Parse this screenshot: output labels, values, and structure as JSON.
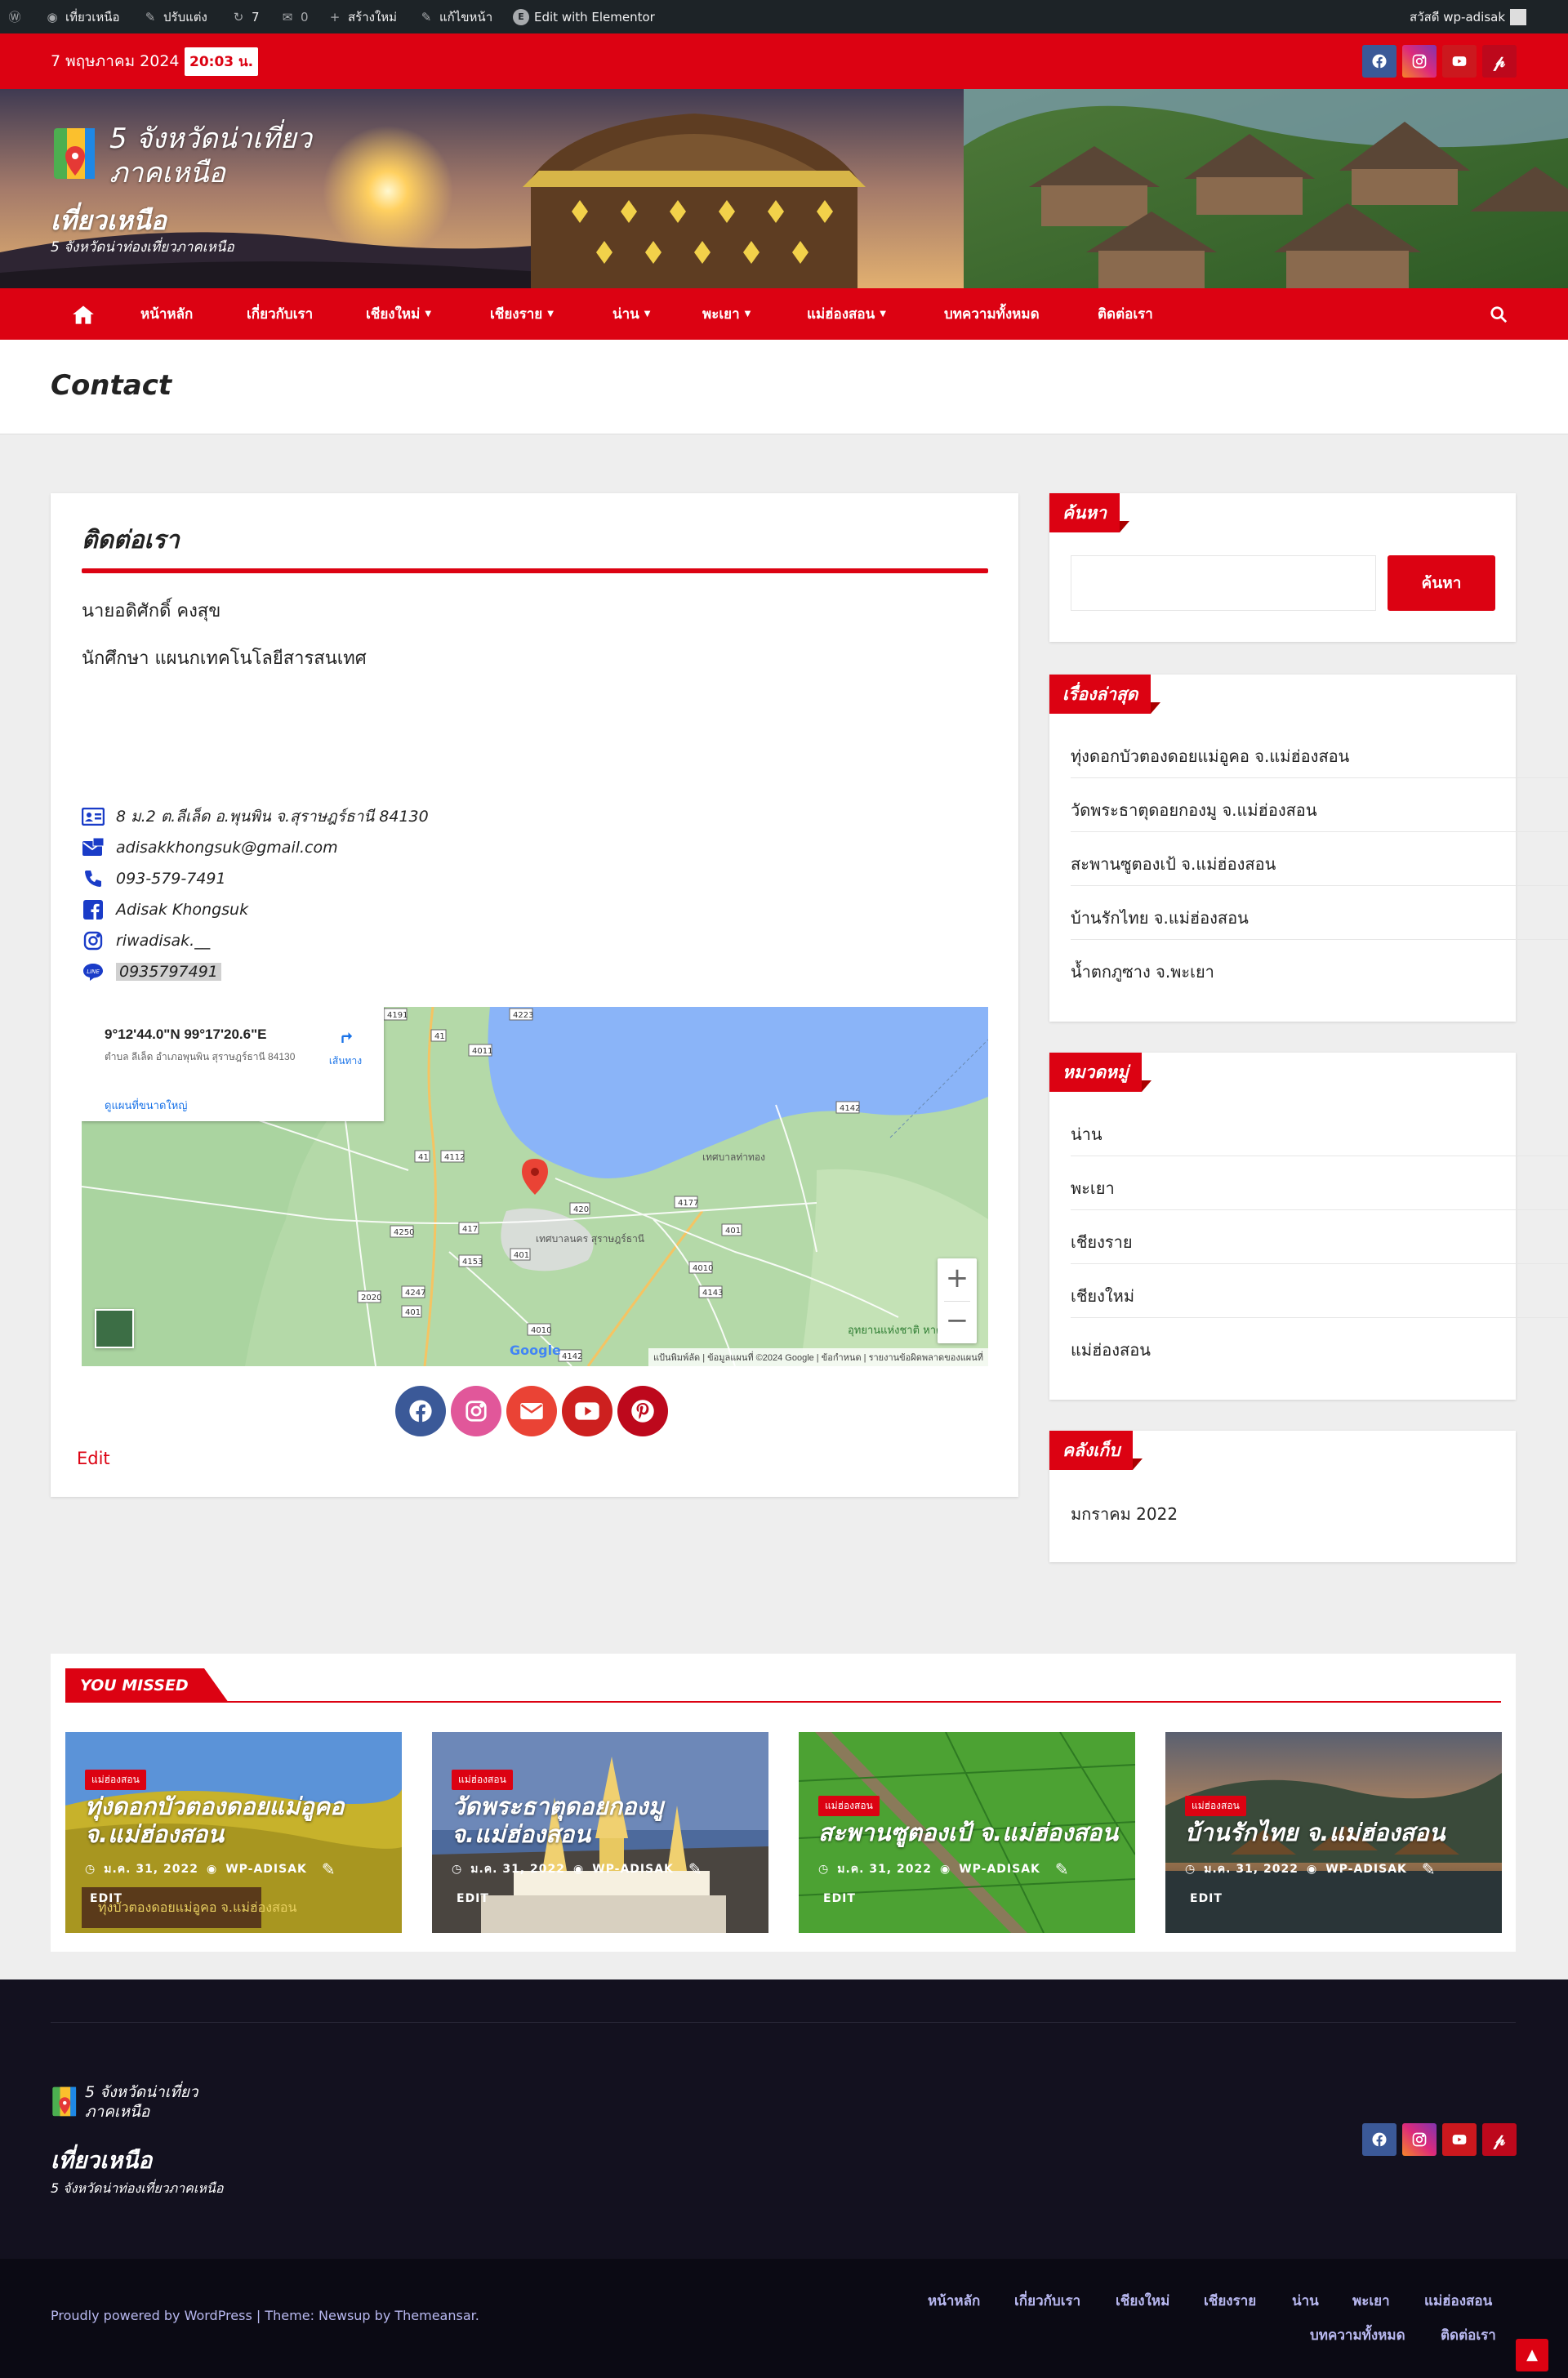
{
  "adminbar": {
    "items": [
      "เที่ยวเหนือ",
      "ปรับแต่ง",
      "7",
      "0",
      "สร้างใหม่",
      "แก้ไขหน้า",
      "Edit with Elementor"
    ],
    "greeting": "สวัสดี wp-adisak"
  },
  "topbar": {
    "date": "7 พฤษภาคม 2024",
    "time": "20:03 น."
  },
  "site": {
    "logo_text_line1": "5 จังหวัดน่าเที่ยว",
    "logo_text_line2": "ภาคเหนือ",
    "title": "เที่ยวเหนือ",
    "tagline": "5 จังหวัดน่าท่องเที่ยวภาคเหนือ"
  },
  "nav": {
    "items": [
      "หน้าหลัก",
      "เกี่ยวกับเรา",
      "เชียงใหม่",
      "เชียงราย",
      "น่าน",
      "พะเยา",
      "แม่ฮ่องสอน",
      "บทความทั้งหมด",
      "ติดต่อเรา"
    ]
  },
  "page": {
    "title": "Contact"
  },
  "contact": {
    "heading": "ติดต่อเรา",
    "name": "นายอดิศักดิ์ คงสุข",
    "role": "นักศึกษา แผนกเทคโนโลยีสารสนเทศ",
    "address": "8 ม.2 ต.ลีเล็ด อ.พุนพิน จ.สุราษฎร์ธานี 84130",
    "email": "adisakkhongsuk@gmail.com",
    "phone": "093-579-7491",
    "facebook": "Adisak Khongsuk",
    "instagram": "riwadisak.__",
    "line": "0935797491",
    "edit_label": "Edit"
  },
  "map": {
    "coords": "9°12'44.0\"N 99°17'20.6\"E",
    "place": "ตำบล ลีเล็ด อำเภอพุนพิน สุราษฎร์ธานี 84130",
    "directions": "เส้นทาง",
    "larger_map": "ดูแผนที่ขนาดใหญ่",
    "attribution": "แป้นพิมพ์ลัด | ข้อมูลแผนที่ ©2024 Google | ข้อกำหนด | รายงานข้อผิดพลาดของแผนที่",
    "zoom_in": "+",
    "zoom_out": "−",
    "google": "Google",
    "labels": [
      "เทศบาลท่าทอง",
      "เทศบาลนคร สุราษฎร์ธานี",
      "อุทยานแห่งชาติ หาดขนอม"
    ],
    "roads": [
      "4191",
      "41",
      "4011",
      "4223",
      "41",
      "4112",
      "417",
      "4250",
      "4153",
      "401",
      "420",
      "4177",
      "401",
      "4142",
      "4010",
      "4143",
      "2020",
      "4247",
      "401",
      "4010",
      "4142"
    ]
  },
  "social_circle": {
    "items": [
      "facebook-icon",
      "instagram-icon",
      "envelope-icon",
      "youtube-icon",
      "pinterest-icon"
    ]
  },
  "sidebar": {
    "search": {
      "title": "ค้นหา",
      "button": "ค้นหา"
    },
    "recent": {
      "title": "เรื่องล่าสุด",
      "items": [
        "ทุ่งดอกบัวตองดอยแม่อูคอ จ.แม่ฮ่องสอน",
        "วัดพระธาตุดอยกองมู จ.แม่ฮ่องสอน",
        "สะพานซูตองเป้ จ.แม่ฮ่องสอน",
        "บ้านรักไทย จ.แม่ฮ่องสอน",
        "น้ำตกภูซาง จ.พะเยา"
      ]
    },
    "categories": {
      "title": "หมวดหมู่",
      "items": [
        "น่าน",
        "พะเยา",
        "เชียงราย",
        "เชียงใหม่",
        "แม่ฮ่องสอน"
      ]
    },
    "archive": {
      "title": "คลังเก็บ",
      "items": [
        "มกราคม 2022"
      ]
    }
  },
  "missed": {
    "title": "YOU MISSED",
    "posts": [
      {
        "cat": "แม่ฮ่องสอน",
        "title": "ทุ่งดอกบัวตองดอยแม่อูคอ จ.แม่ฮ่องสอน",
        "date": "ม.ค. 31, 2022",
        "author": "WP-ADISAK",
        "edit": "EDIT",
        "sign": "ทุ่งบัวตองดอยแม่อูคอ จ.แม่ฮ่องสอน"
      },
      {
        "cat": "แม่ฮ่องสอน",
        "title": "วัดพระธาตุดอยกองมู จ.แม่ฮ่องสอน",
        "date": "ม.ค. 31, 2022",
        "author": "WP-ADISAK",
        "edit": "EDIT"
      },
      {
        "cat": "แม่ฮ่องสอน",
        "title": "สะพานซูตองเป้ จ.แม่ฮ่องสอน",
        "date": "ม.ค. 31, 2022",
        "author": "WP-ADISAK",
        "edit": "EDIT"
      },
      {
        "cat": "แม่ฮ่องสอน",
        "title": "บ้านรักไทย จ.แม่ฮ่องสอน",
        "date": "ม.ค. 31, 2022",
        "author": "WP-ADISAK",
        "edit": "EDIT"
      }
    ]
  },
  "footer": {
    "logo_line1": "5 จังหวัดน่าเที่ยว",
    "logo_line2": "ภาคเหนือ",
    "title": "เที่ยวเหนือ",
    "tagline": "5 จังหวัดน่าท่องเที่ยวภาคเหนือ",
    "credit": "Proudly powered by WordPress | Theme: Newsup by Themeansar.",
    "menu": [
      "หน้าหลัก",
      "เกี่ยวกับเรา",
      "เชียงใหม่",
      "เชียงราย",
      "น่าน",
      "พะเยา",
      "แม่ฮ่องสอน",
      "บทความทั้งหมด",
      "ติดต่อเรา"
    ]
  },
  "colors": {
    "primary": "#dc0212",
    "dark": "#1d2327",
    "footer": "#13111f",
    "footer_bottom": "#0b0a14"
  }
}
